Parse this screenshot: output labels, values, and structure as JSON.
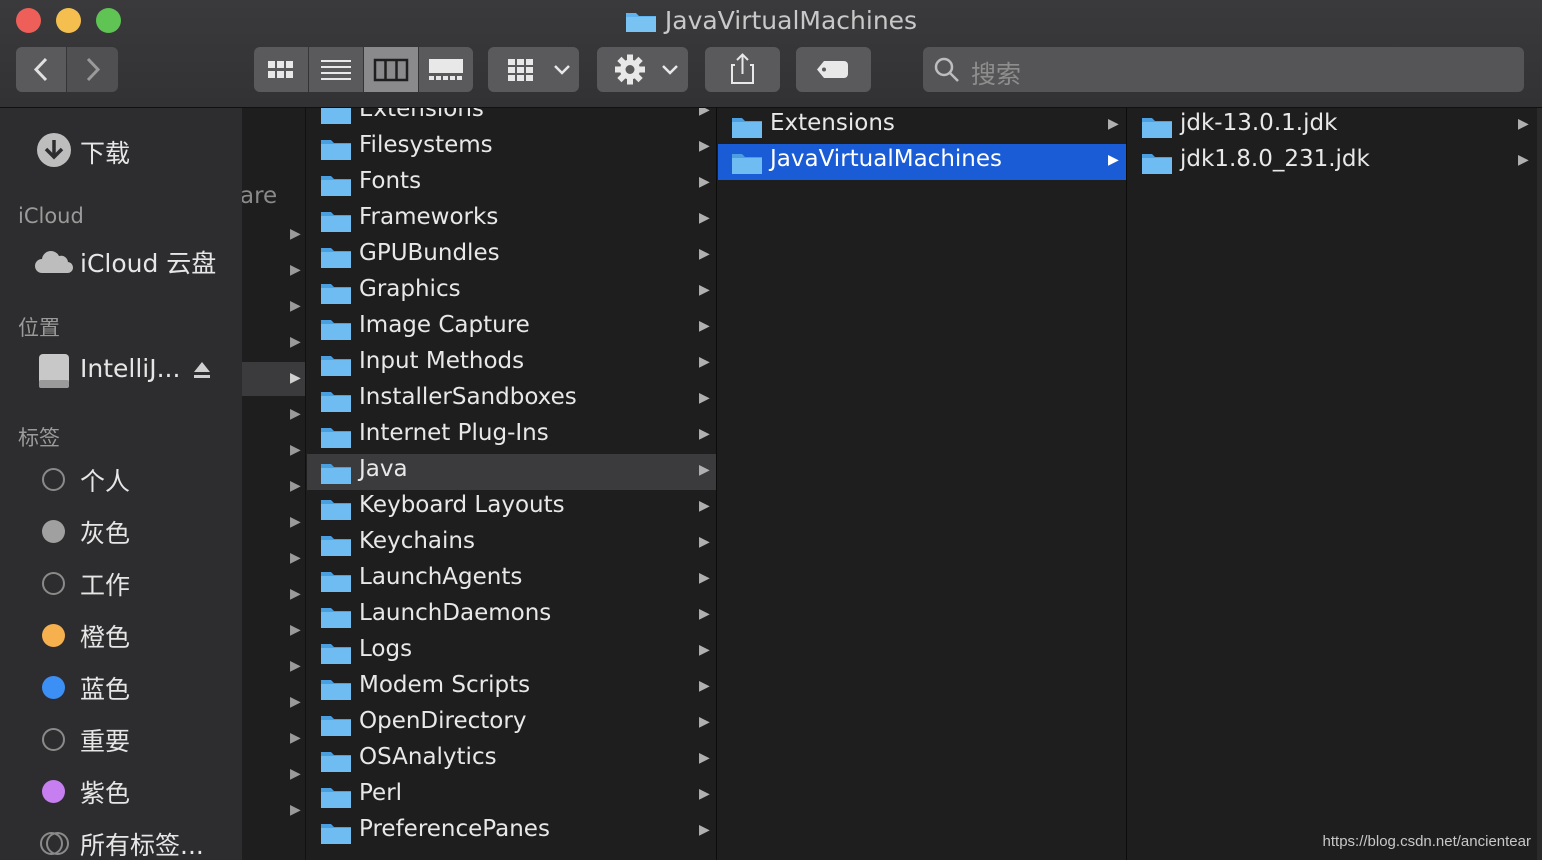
{
  "window": {
    "title": "JavaVirtualMachines"
  },
  "toolbar": {
    "search_placeholder": "搜索",
    "back_icon": "chevron-left-icon",
    "forward_icon": "chevron-right-icon"
  },
  "sidebar": {
    "top_item": "下载",
    "icloud_header": "iCloud",
    "icloud_item": "iCloud 云盘",
    "locations_header": "位置",
    "location_item": "IntelliJ...",
    "tags_header": "标签",
    "tags": [
      {
        "label": "个人",
        "color": "hollow"
      },
      {
        "label": "灰色",
        "color": "#a0a0a0"
      },
      {
        "label": "工作",
        "color": "hollow"
      },
      {
        "label": "橙色",
        "color": "#f6b04e"
      },
      {
        "label": "蓝色",
        "color": "#3b8ff5"
      },
      {
        "label": "重要",
        "color": "hollow"
      },
      {
        "label": "紫色",
        "color": "#c77ef1"
      }
    ],
    "all_tags": "所有标签..."
  },
  "column0": {
    "partial_text": "are"
  },
  "column1": {
    "items": [
      "Extensions",
      "Filesystems",
      "Fonts",
      "Frameworks",
      "GPUBundles",
      "Graphics",
      "Image Capture",
      "Input Methods",
      "InstallerSandboxes",
      "Internet Plug-Ins",
      "Java",
      "Keyboard Layouts",
      "Keychains",
      "LaunchAgents",
      "LaunchDaemons",
      "Logs",
      "Modem Scripts",
      "OpenDirectory",
      "OSAnalytics",
      "Perl",
      "PreferencePanes"
    ],
    "highlighted": "Java"
  },
  "column2": {
    "items": [
      "Extensions",
      "JavaVirtualMachines"
    ],
    "selected": "JavaVirtualMachines"
  },
  "column3": {
    "items": [
      "jdk-13.0.1.jdk",
      "jdk1.8.0_231.jdk"
    ]
  },
  "watermark": "https://blog.csdn.net/ancientear",
  "colors": {
    "selection": "#1a5bd6",
    "folder": "#5fb3ef"
  }
}
